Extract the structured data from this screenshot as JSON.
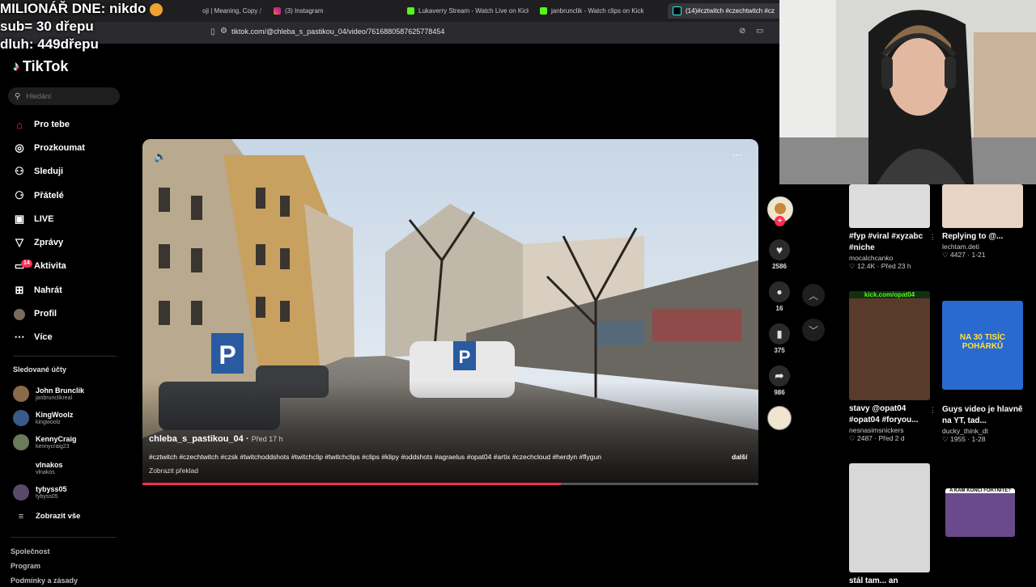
{
  "browser": {
    "tabs": [
      {
        "label": "oji | Meaning, Copy ⧸"
      },
      {
        "label": "(3) Instagram"
      },
      {
        "label": "Lukaverry Stream - Watch Live on Kick"
      },
      {
        "label": "janbrunclik - Watch clips on Kick"
      },
      {
        "label": "(14)#cztwitch #czechtwitch #cz"
      }
    ],
    "url": "tiktok.com/@chleba_s_pastikou_04/video/7616880587625778454"
  },
  "stream_overlay": {
    "line1": "MILIONÁŘ DNE: nikdo",
    "line2": "sub= 30 dřepu",
    "line3": "dluh: 449dřepu"
  },
  "sidebar": {
    "logo": "TikTok",
    "search_placeholder": "Hledání",
    "nav": [
      {
        "label": "Pro tebe",
        "icon": "home-icon"
      },
      {
        "label": "Prozkoumat",
        "icon": "compass-icon"
      },
      {
        "label": "Sleduji",
        "icon": "following-icon"
      },
      {
        "label": "Přátelé",
        "icon": "friends-icon"
      },
      {
        "label": "LIVE",
        "icon": "live-icon"
      },
      {
        "label": "Zprávy",
        "icon": "messages-icon"
      },
      {
        "label": "Aktivita",
        "icon": "activity-icon",
        "badge": "14"
      },
      {
        "label": "Nahrát",
        "icon": "upload-icon"
      },
      {
        "label": "Profil",
        "icon": "profile-icon"
      },
      {
        "label": "Více",
        "icon": "more-icon"
      }
    ],
    "following_title": "Sledované účty",
    "accounts": [
      {
        "name": "John Brunclik",
        "handle": "janbrunclikreal",
        "color": "#8a6a4a"
      },
      {
        "name": "KingWoolz",
        "handle": "kingwoolz",
        "color": "#3a5a8a"
      },
      {
        "name": "KennyCraig",
        "handle": "kennycraig23",
        "color": "#6a7a5a"
      },
      {
        "name": "vlnakos",
        "handle": "vlnakos",
        "color": "#000000"
      },
      {
        "name": "tybyss05",
        "handle": "tybyss05",
        "color": "#5a4a6a"
      }
    ],
    "show_all": "Zobrazit vše",
    "footer": [
      "Společnost",
      "Program",
      "Podmínky a zásady"
    ]
  },
  "video": {
    "author": "chleba_s_pastikou_04",
    "posted": "Před 17 h",
    "caption": "#cztwitch #czechtwitch #czsk #twitchoddshots #twitchclip #twitchclips #clips #klipy #oddshots #agraelus #opat04 #artix #czechcloud #herdyn #flygun",
    "more": "další",
    "translate": "Zobrazit překlad",
    "progress": 0.68
  },
  "actions": {
    "likes": "2586",
    "comments": "16",
    "saves": "375",
    "shares": "986"
  },
  "recommended": [
    {
      "title": "#fyp #viral #xyzabc #niche",
      "author": "mocalchcanko",
      "likes": "12.4K",
      "time": "Před 23 h"
    },
    {
      "title": "Replying to @...",
      "author": "lechtam.deti",
      "likes": "4427",
      "time": "1-21"
    },
    {
      "title": "stavy @opat04 #opat04 #foryou...",
      "author": "nesnasimsnickers",
      "likes": "2487",
      "time": "Před 2 d"
    },
    {
      "title": "Guys video je hlavně na YT, tad...",
      "author": "ducky_think_dt",
      "likes": "1955",
      "time": "1-28"
    },
    {
      "title": "stál tam... an",
      "author": "",
      "likes": "",
      "time": ""
    }
  ],
  "thumb_texts": {
    "kick": "kick.com/opat04",
    "tiktok_card": "NA 30 TISÍC POHÁRKŮ",
    "small_banner": "A KAM KONČÍ FORTNITE?"
  }
}
